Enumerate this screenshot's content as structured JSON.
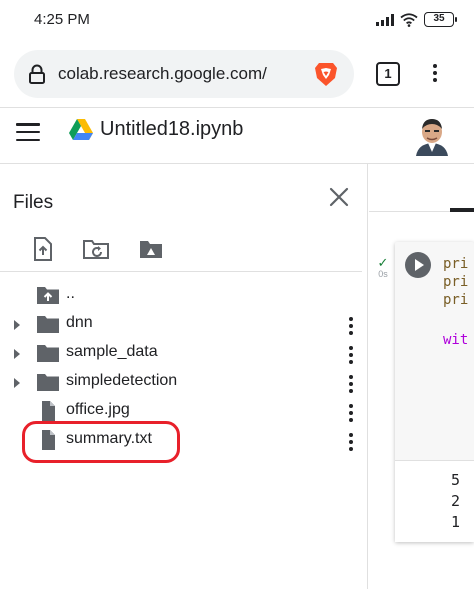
{
  "status_bar": {
    "time": "4:25 PM",
    "battery": "35",
    "icons": [
      "signal-icon",
      "wifi-icon",
      "battery-icon"
    ]
  },
  "browser": {
    "url": "colab.research.google.com/",
    "tab_count": "1",
    "icons": [
      "lock-icon",
      "brave-icon",
      "tabs-icon",
      "more-vert-icon"
    ]
  },
  "header": {
    "notebook_title": "Untitled18.ipynb",
    "icons": [
      "menu-icon",
      "google-drive-icon",
      "avatar"
    ]
  },
  "files": {
    "title": "Files",
    "toolbar_icons": [
      "upload-file-icon",
      "refresh-folder-icon",
      "mount-drive-icon"
    ],
    "items": [
      {
        "label": "..",
        "type": "parent-folder",
        "expandable": false,
        "has_menu": false
      },
      {
        "label": "dnn",
        "type": "folder",
        "expandable": true,
        "has_menu": true
      },
      {
        "label": "sample_data",
        "type": "folder",
        "expandable": true,
        "has_menu": true
      },
      {
        "label": "simpledetection",
        "type": "folder",
        "expandable": true,
        "has_menu": true
      },
      {
        "label": "office.jpg",
        "type": "file",
        "expandable": false,
        "has_menu": true
      },
      {
        "label": "summary.txt",
        "type": "file",
        "expandable": false,
        "has_menu": true
      }
    ],
    "highlighted_item": "summary.txt",
    "highlight_color": "#e8202a"
  },
  "notebook": {
    "cell_status": "0s",
    "code_lines": [
      "pri",
      "pri",
      "pri",
      "",
      "wit"
    ],
    "output_lines": [
      "5",
      "2",
      "1"
    ],
    "colors": {
      "print": "#795e26",
      "keyword": "#af00db",
      "check": "#188038"
    }
  }
}
